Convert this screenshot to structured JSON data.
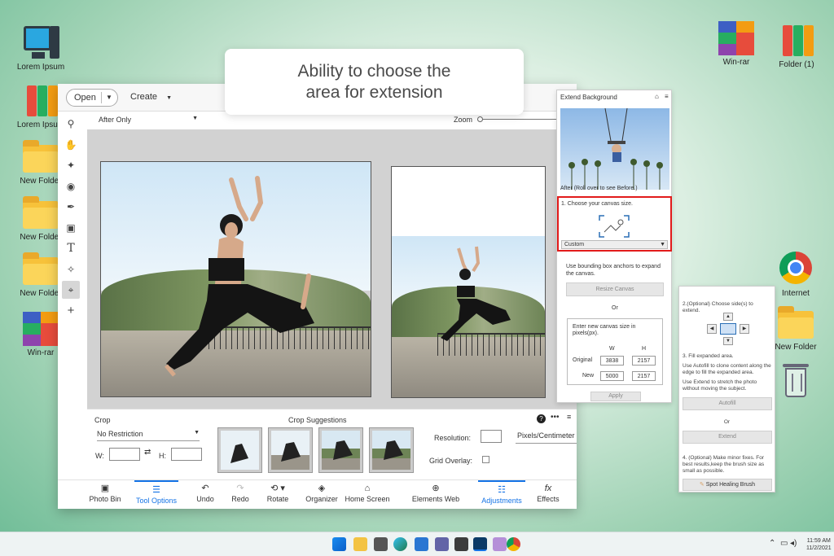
{
  "desktop_left": [
    {
      "label": "Lorem Ipsum",
      "icon": "computer-icon"
    },
    {
      "label": "Lorem Ipsum",
      "icon": "binders-icon"
    },
    {
      "label": "New Folder",
      "icon": "folder-icon"
    },
    {
      "label": "New Folder",
      "icon": "folder-icon"
    },
    {
      "label": "New Folder",
      "icon": "folder-icon"
    },
    {
      "label": "Win-rar",
      "icon": "winrar-icon"
    }
  ],
  "desktop_right": [
    {
      "label": "Win-rar",
      "icon": "winrar-icon"
    },
    {
      "label": "Folder (1)",
      "icon": "binders-icon"
    },
    {
      "label": "Internet",
      "icon": "chrome-icon"
    },
    {
      "label": "New Folder",
      "icon": "folder-icon"
    },
    {
      "label": "",
      "icon": "recycle-bin-icon"
    }
  ],
  "caption": {
    "line1": "Ability to choose the",
    "line2": "area for extension"
  },
  "editor": {
    "open_label": "Open",
    "create_label": "Create",
    "view_mode": "After Only",
    "zoom_label": "Zoom",
    "zoom_value": "14",
    "tools": [
      "zoom-icon",
      "hand-icon",
      "quick-select-icon",
      "eye-icon",
      "brush-icon",
      "stamp-icon",
      "text-icon",
      "spot-heal-icon",
      "crop-icon",
      "move-icon"
    ],
    "crop_label": "Crop",
    "crop_mode": "No Restriction",
    "w_label": "W:",
    "h_label": "H:",
    "suggestions_label": "Crop Suggestions",
    "resolution_label": "Resolution:",
    "resolution_unit": "Pixels/Centimeter",
    "grid_label": "Grid Overlay:",
    "nav": [
      {
        "label": "Photo Bin",
        "icon": "photo-bin-icon"
      },
      {
        "label": "Tool Options",
        "icon": "tool-options-icon",
        "active": true
      },
      {
        "label": "Undo",
        "icon": "undo-icon"
      },
      {
        "label": "Redo",
        "icon": "redo-icon"
      },
      {
        "label": "Rotate",
        "icon": "rotate-icon"
      },
      {
        "label": "Organizer",
        "icon": "organizer-icon"
      },
      {
        "label": "Home Screen",
        "icon": "home-icon"
      },
      {
        "label": "Elements Web",
        "icon": "globe-icon"
      },
      {
        "label": "Adjustments",
        "icon": "sliders-icon",
        "active": true
      },
      {
        "label": "Effects",
        "icon": "fx-icon"
      }
    ]
  },
  "extend_panel": {
    "title": "Extend Background",
    "after_note": "After (Roll over to see Before.)",
    "step1": "1. Choose your canvas size.",
    "size_option": "Custom",
    "anchor_note": "Use bounding box anchors to expand the canvas.",
    "resize_button": "Resize Canvas",
    "or_label": "Or",
    "enter_note": "Enter new canvas size in pixels(px).",
    "col_w": "W",
    "col_h": "H",
    "original_label": "Original",
    "original_w": "3838",
    "original_h": "2157",
    "new_label": "New",
    "new_w": "5000",
    "new_h": "2157",
    "apply_button": "Apply"
  },
  "options_panel": {
    "step2": "2.(Optional) Choose side(s) to extend.",
    "step3": "3. Fill expanded area.",
    "autofill_note": "Use Autofill to clone content along the edge to fill the expanded area.",
    "extend_note": "Use Extend to stretch the photo without moving the subject.",
    "autofill_button": "Autofill",
    "or_label": "Or",
    "extend_button": "Extend",
    "step4": "4. (Optional) Make minor fixes. For best results,keep the brush size as small as possible.",
    "heal_button": "Spot Healing Brush"
  },
  "taskbar": {
    "time": "11:59 AM",
    "date": "11/2/2021"
  },
  "colors": {
    "accent": "#1473e6",
    "highlight_box": "#e21b1b"
  }
}
